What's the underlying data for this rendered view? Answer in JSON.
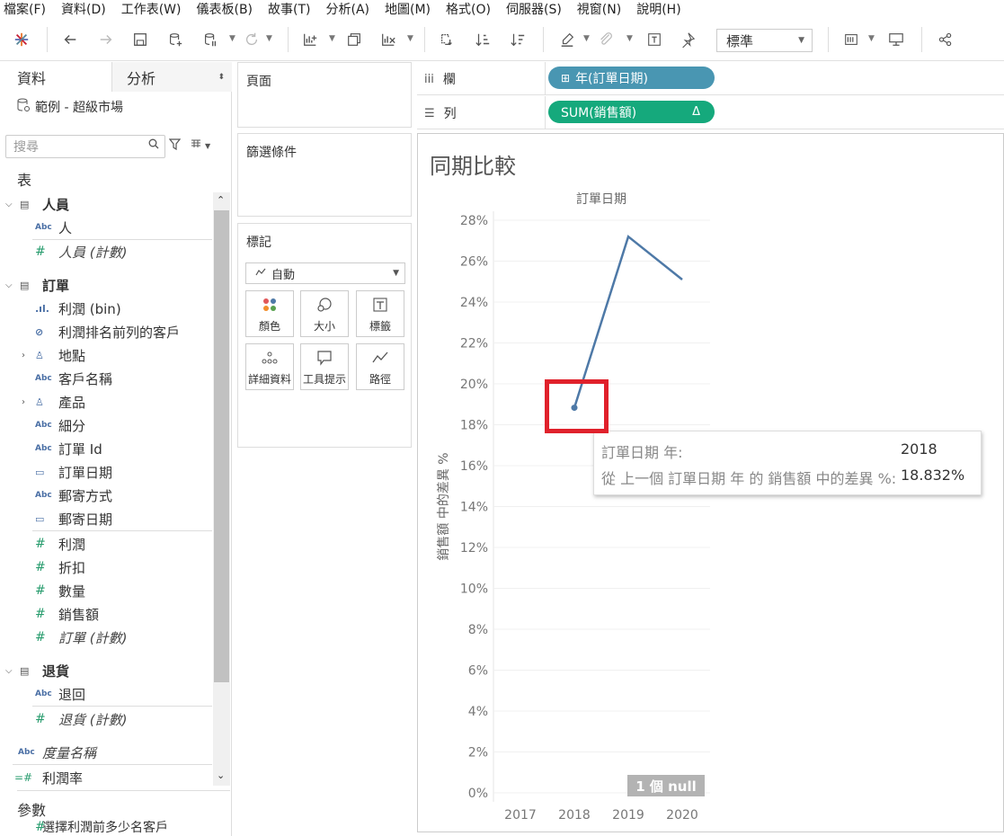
{
  "menu": [
    "檔案(F)",
    "資料(D)",
    "工作表(W)",
    "儀表板(B)",
    "故事(T)",
    "分析(A)",
    "地圖(M)",
    "格式(O)",
    "伺服器(S)",
    "視窗(N)",
    "說明(H)"
  ],
  "toolbar": {
    "fit_value": "標準"
  },
  "left_pane": {
    "tab_data": "資料",
    "tab_analysis": "分析",
    "datasource": "範例 - 超級市場",
    "search_placeholder": "搜尋",
    "tables_title": "表",
    "parameters_title": "參數",
    "parameter_item": "選擇利潤前多少名客戶",
    "groups": {
      "people": {
        "label": "人員",
        "items": [
          "人",
          "人員 (計數)"
        ]
      },
      "orders": {
        "label": "訂單",
        "items": [
          "利潤 (bin)",
          "利潤排名前列的客戶",
          "地點",
          "客戶名稱",
          "產品",
          "細分",
          "訂單 Id",
          "訂單日期",
          "郵寄方式",
          "郵寄日期",
          "利潤",
          "折扣",
          "數量",
          "銷售額",
          "訂單 (計數)"
        ]
      },
      "returns": {
        "label": "退貨",
        "items": [
          "退回",
          "退貨 (計數)"
        ]
      }
    },
    "extra_items": [
      "度量名稱",
      "利潤率"
    ],
    "field_type_abc": "Abc"
  },
  "panels": {
    "pages_title": "頁面",
    "filters_title": "篩選條件",
    "marks_title": "標記",
    "marks_type": "自動",
    "mark_buttons": [
      "顏色",
      "大小",
      "標籤",
      "詳細資料",
      "工具提示",
      "路徑"
    ]
  },
  "shelves": {
    "columns_label": "欄",
    "rows_label": "列",
    "columns_pill": "年(訂單日期)",
    "rows_pill": "SUM(銷售額)",
    "delta_symbol": "Δ"
  },
  "viz": {
    "title": "同期比較",
    "null_badge": "1 個 null",
    "tooltip": {
      "label1": "訂單日期 年:",
      "value1": "2018",
      "label2": "從 上一個 訂單日期 年 的 銷售額 中的差異 %:",
      "value2": "18.832%"
    }
  },
  "chart_data": {
    "type": "line",
    "title": "",
    "xlabel": "訂單日期",
    "ylabel": "銷售額 中的差異 %",
    "categories": [
      "2017",
      "2018",
      "2019",
      "2020"
    ],
    "series": [
      {
        "values": [
          null,
          18.832,
          27.2,
          25.1
        ]
      }
    ],
    "ylim": [
      0,
      28
    ],
    "yticks": [
      "0%",
      "2%",
      "4%",
      "6%",
      "8%",
      "10%",
      "12%",
      "14%",
      "16%",
      "18%",
      "20%",
      "22%",
      "24%",
      "26%",
      "28%"
    ],
    "line_color": "#4e79a7",
    "grid": true
  }
}
